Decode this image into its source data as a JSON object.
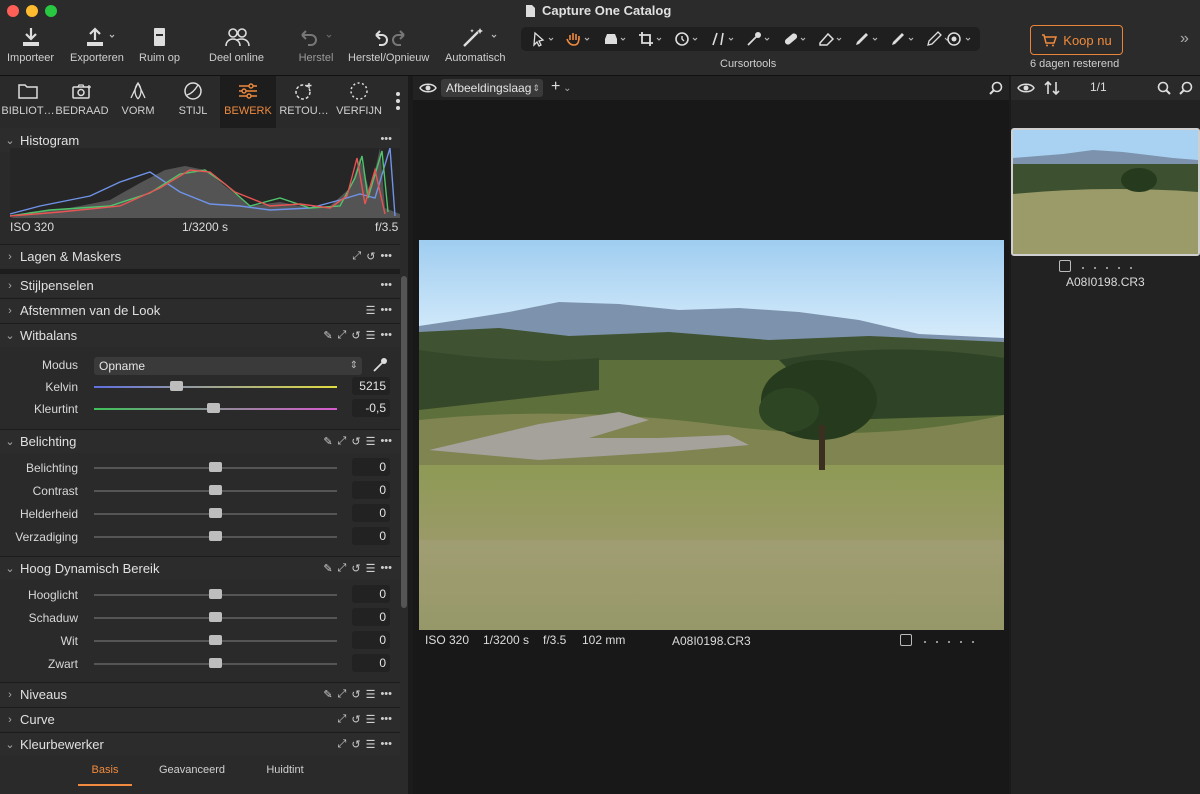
{
  "window": {
    "title": "Capture One Catalog"
  },
  "toolbar": {
    "buttons": [
      {
        "label": "Importeer"
      },
      {
        "label": "Exporteren"
      },
      {
        "label": "Ruim op"
      },
      {
        "label": "Deel online"
      },
      {
        "label": "Herstel"
      },
      {
        "label": "Herstel/Opnieuw"
      },
      {
        "label": "Automatisch"
      }
    ],
    "cursortools_label": "Cursortools",
    "buy": {
      "label": "Koop nu",
      "subtext": "6 dagen resterend"
    }
  },
  "tabs": [
    {
      "label": "BIBLIOT…"
    },
    {
      "label": "BEDRAAD"
    },
    {
      "label": "VORM"
    },
    {
      "label": "STIJL"
    },
    {
      "label": "BEWERK",
      "active": true
    },
    {
      "label": "RETOU…"
    },
    {
      "label": "VERFIJN"
    }
  ],
  "histogram": {
    "title": "Histogram",
    "iso": "ISO 320",
    "shutter": "1/3200 s",
    "aperture": "f/3.5"
  },
  "sections": {
    "layers": "Lagen & Maskers",
    "style_brushes": "Stijlpenselen",
    "look": "Afstemmen van de Look",
    "white_balance": "Witbalans",
    "exposure": "Belichting",
    "hdr": "Hoog Dynamisch Bereik",
    "levels": "Niveaus",
    "curve": "Curve",
    "color_editor": "Kleurbewerker"
  },
  "white_balance": {
    "mode_label": "Modus",
    "mode_value": "Opname",
    "kelvin_label": "Kelvin",
    "kelvin_value": "5215",
    "kelvin_pos": 0.34,
    "tint_label": "Kleurtint",
    "tint_value": "-0,5",
    "tint_pos": 0.49
  },
  "exposure": {
    "rows": [
      {
        "label": "Belichting",
        "value": "0"
      },
      {
        "label": "Contrast",
        "value": "0"
      },
      {
        "label": "Helderheid",
        "value": "0"
      },
      {
        "label": "Verzadiging",
        "value": "0"
      }
    ]
  },
  "hdr": {
    "rows": [
      {
        "label": "Hooglicht",
        "value": "0"
      },
      {
        "label": "Schaduw",
        "value": "0"
      },
      {
        "label": "Wit",
        "value": "0"
      },
      {
        "label": "Zwart",
        "value": "0"
      }
    ]
  },
  "color_editor": {
    "tabs": [
      "Basis",
      "Geavanceerd",
      "Huidtint"
    ],
    "active_tab": "Basis"
  },
  "viewer": {
    "layer_select": "Afbeeldingslaag",
    "iso": "ISO 320",
    "shutter": "1/3200 s",
    "aperture": "f/3.5",
    "focal": "102 mm",
    "filename": "A08I0198.CR3"
  },
  "browser": {
    "count": "1/1",
    "filename": "A08I0198.CR3"
  },
  "colors": {
    "accent": "#ef8a3e",
    "panel": "#2a2a2a",
    "viewer_bg": "#181818"
  }
}
